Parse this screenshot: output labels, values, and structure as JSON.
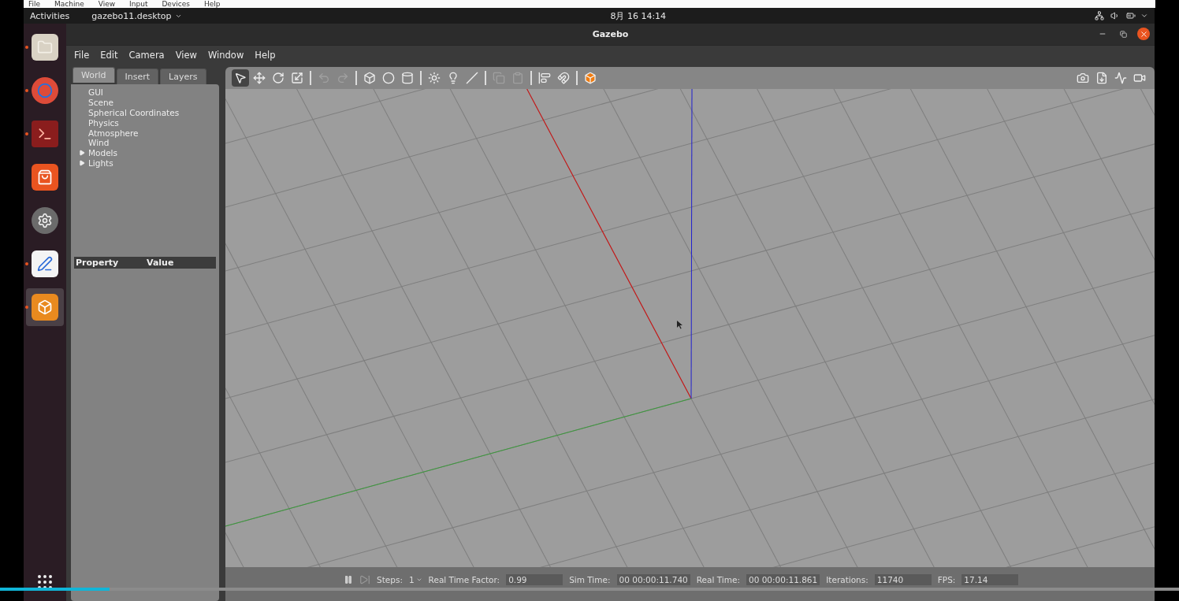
{
  "vm_menu": [
    "File",
    "Machine",
    "View",
    "Input",
    "Devices",
    "Help"
  ],
  "top_bar": {
    "activities": "Activities",
    "app_menu": "gazebo11.desktop",
    "clock": "8月 16 14:14"
  },
  "dock": [
    {
      "kind": "files",
      "running": true,
      "active": false
    },
    {
      "kind": "browser",
      "running": true,
      "active": false
    },
    {
      "kind": "terminal",
      "running": true,
      "active": false
    },
    {
      "kind": "store",
      "running": false,
      "active": false
    },
    {
      "kind": "settings",
      "running": false,
      "active": false
    },
    {
      "kind": "editor",
      "running": true,
      "active": false
    },
    {
      "kind": "gazebo",
      "running": true,
      "active": true
    }
  ],
  "window": {
    "title": "Gazebo"
  },
  "menu": [
    "File",
    "Edit",
    "Camera",
    "View",
    "Window",
    "Help"
  ],
  "tabs": [
    {
      "label": "World",
      "selected": true
    },
    {
      "label": "Insert",
      "selected": false
    },
    {
      "label": "Layers",
      "selected": false
    }
  ],
  "tree": [
    {
      "label": "GUI"
    },
    {
      "label": "Scene"
    },
    {
      "label": "Spherical Coordinates"
    },
    {
      "label": "Physics"
    },
    {
      "label": "Atmosphere"
    },
    {
      "label": "Wind"
    },
    {
      "label": "Models",
      "expanded": false
    },
    {
      "label": "Lights",
      "expanded": false
    }
  ],
  "property_table": {
    "columns": [
      "Property",
      "Value"
    ]
  },
  "toolbar": {
    "groups": [
      [
        {
          "kind": "select",
          "selected": true,
          "disabled": false
        },
        {
          "kind": "translate",
          "selected": false,
          "disabled": false
        },
        {
          "kind": "rotate",
          "selected": false,
          "disabled": false
        },
        {
          "kind": "scale",
          "selected": false,
          "disabled": false
        }
      ],
      [
        {
          "kind": "undo",
          "selected": false,
          "disabled": true
        },
        {
          "kind": "redo",
          "selected": false,
          "disabled": true
        }
      ],
      [
        {
          "kind": "box",
          "selected": false,
          "disabled": false
        },
        {
          "kind": "sphere",
          "selected": false,
          "disabled": false
        },
        {
          "kind": "cylinder",
          "selected": false,
          "disabled": false
        }
      ],
      [
        {
          "kind": "point_light",
          "selected": false,
          "disabled": false
        },
        {
          "kind": "spot_light",
          "selected": false,
          "disabled": false
        },
        {
          "kind": "directional_light",
          "selected": false,
          "disabled": false
        }
      ],
      [
        {
          "kind": "copy",
          "selected": false,
          "disabled": true
        },
        {
          "kind": "paste",
          "selected": false,
          "disabled": true
        }
      ],
      [
        {
          "kind": "align",
          "selected": false,
          "disabled": false
        },
        {
          "kind": "snap",
          "selected": false,
          "disabled": false
        }
      ],
      [
        {
          "kind": "view_angle",
          "selected": false,
          "disabled": false
        }
      ]
    ],
    "right": [
      {
        "kind": "screenshot"
      },
      {
        "kind": "log"
      },
      {
        "kind": "plot"
      },
      {
        "kind": "video"
      }
    ]
  },
  "status": {
    "steps_label": "Steps:",
    "steps": "1",
    "fields": [
      {
        "label": "Real Time Factor:",
        "value": "0.99"
      },
      {
        "label": "Sim Time:",
        "value": "00 00:00:11.740"
      },
      {
        "label": "Real Time:",
        "value": "00 00:00:11.861"
      },
      {
        "label": "Iterations:",
        "value": "11740"
      },
      {
        "label": "FPS:",
        "value": "17.14"
      }
    ]
  },
  "video_progress": {
    "level": 0.093
  }
}
